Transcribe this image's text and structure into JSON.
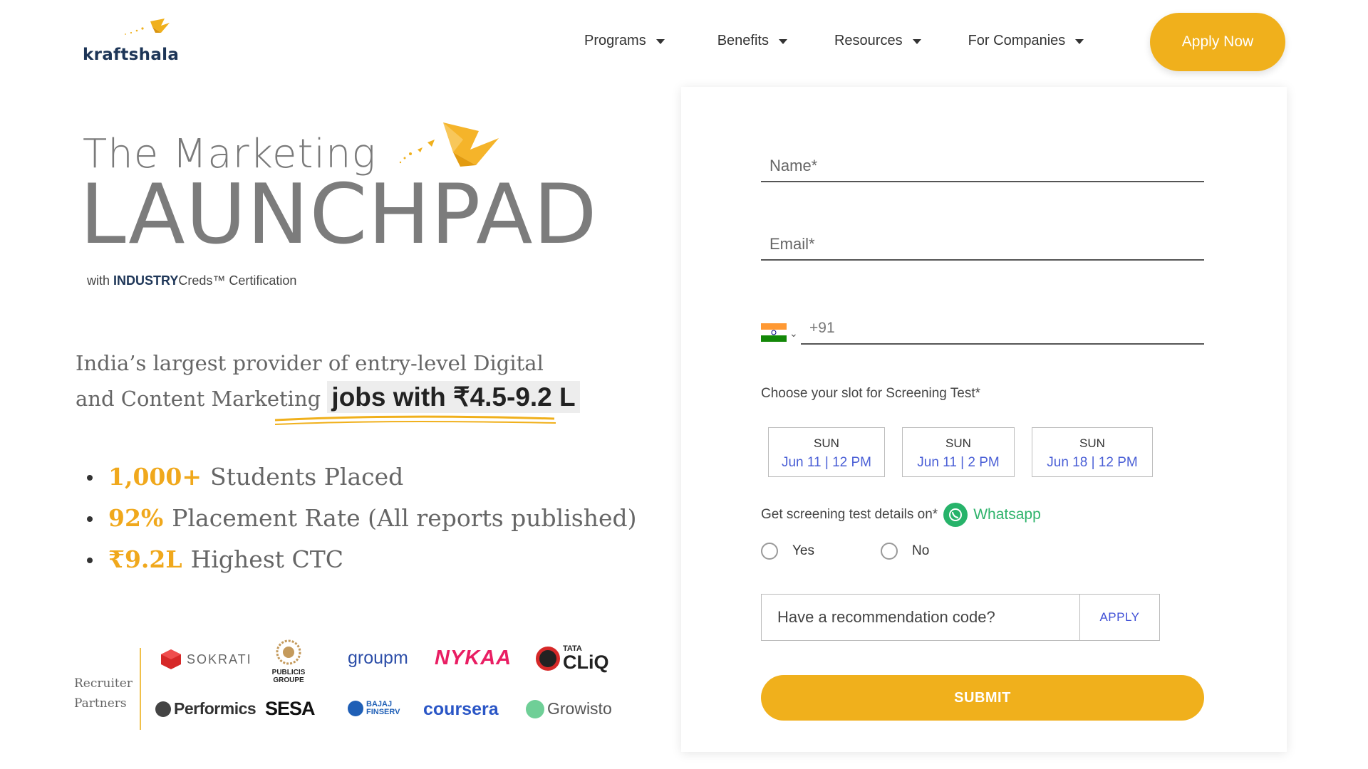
{
  "brand": {
    "name": "kraftshala",
    "accent": "#f0b01c",
    "navy": "#1d3557"
  },
  "nav": {
    "items": [
      {
        "label": "Programs"
      },
      {
        "label": "Benefits"
      },
      {
        "label": "Resources"
      },
      {
        "label": "For Companies"
      }
    ],
    "cta": "Apply Now"
  },
  "hero": {
    "title_small": "The Marketing",
    "title_big": "LAUNCHPAD",
    "cert_prefix": "with ",
    "cert_brand": "INDUSTRY",
    "cert_suffix": "Creds™ Certification",
    "tagline_main": "India’s largest provider of entry-level Digital and Content Marketing ",
    "tagline_highlight": "jobs with ₹4.5-9.2 L",
    "stats": [
      {
        "number": "1,000+",
        "text": "Students Placed"
      },
      {
        "number": "92%",
        "text": "Placement Rate (All reports published)"
      },
      {
        "number": "₹9.2L",
        "text": "Highest CTC"
      }
    ]
  },
  "recruiters": {
    "label_line1": "Recruiter",
    "label_line2": "Partners",
    "logos": [
      "SOKRATI",
      "PUBLICIS",
      "GROUPE",
      "groupm",
      "NYKAA",
      "TATA",
      "CLiQ",
      "Performics",
      "SESA",
      "BAJAJ",
      "FINSERV",
      "coursera",
      "Growisto"
    ]
  },
  "form": {
    "name_placeholder": "Name*",
    "email_placeholder": "Email*",
    "phone_prefix": "+91",
    "slot_label": "Choose your slot for Screening Test*",
    "slots": [
      {
        "day": "SUN",
        "time": "Jun 11 | 12 PM"
      },
      {
        "day": "SUN",
        "time": "Jun 11 | 2 PM"
      },
      {
        "day": "SUN",
        "time": "Jun 18 | 12 PM"
      }
    ],
    "whatsapp_label": "Get screening test details on*",
    "whatsapp_text": "Whatsapp",
    "radio_yes": "Yes",
    "radio_no": "No",
    "code_placeholder": "Have a recommendation code?",
    "code_apply": "APPLY",
    "submit": "SUBMIT"
  }
}
